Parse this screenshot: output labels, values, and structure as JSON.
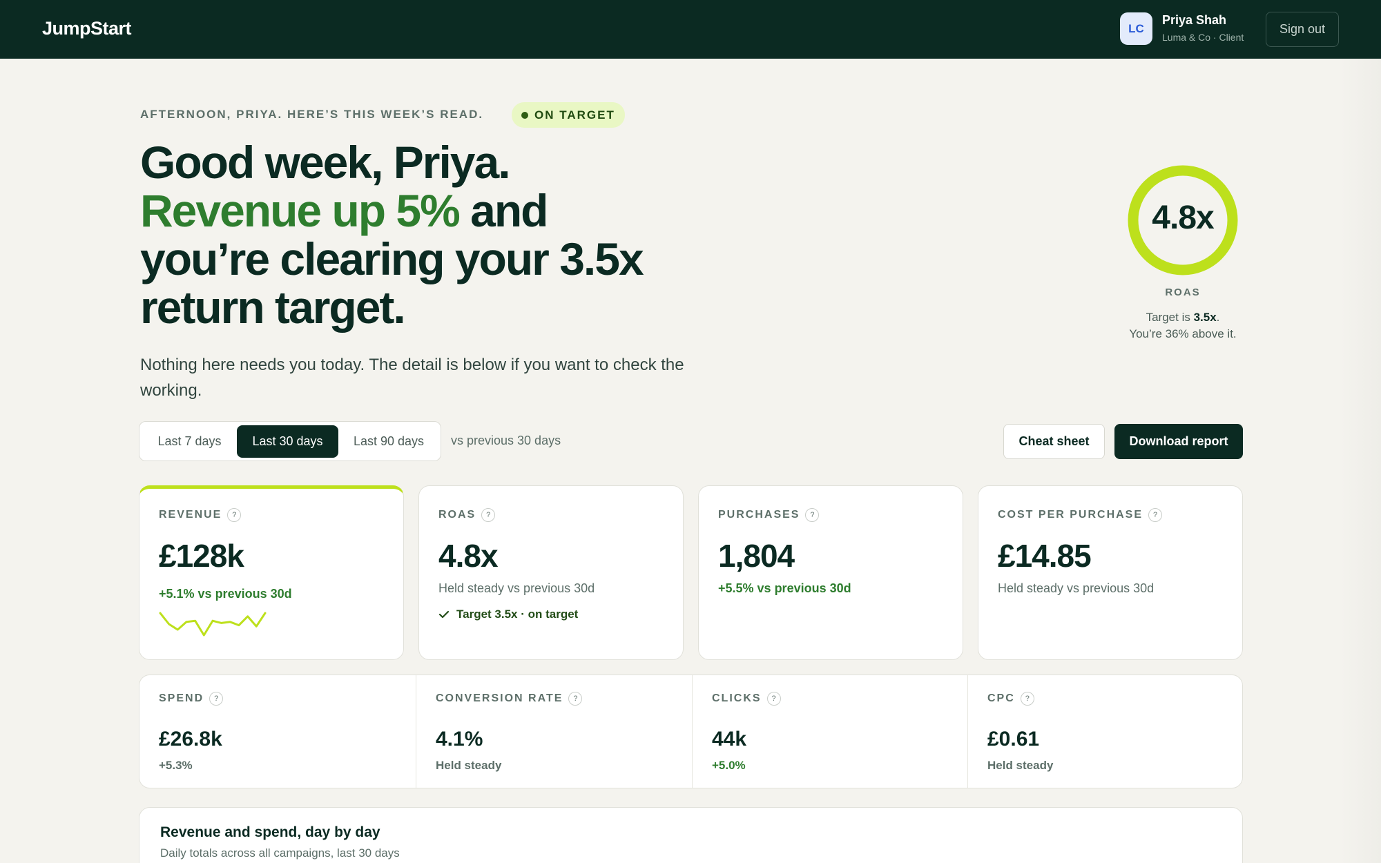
{
  "header": {
    "brand": "JumpStart",
    "avatar_initials": "LC",
    "user_name": "Priya Shah",
    "user_sub": "Luma & Co · Client",
    "signout_label": "Sign out"
  },
  "hero": {
    "kicker": "Afternoon, Priya. Here’s this week’s read.",
    "badge": "ON TARGET",
    "headline_line1": "Good week, Priya.",
    "headline_green": "Revenue up 5%",
    "headline_and": " and",
    "headline_line3": "you’re clearing your 3.5x",
    "headline_line4": "return target.",
    "lede": "Nothing here needs you today. The detail is below if you want to check the working."
  },
  "roas_ring": {
    "value": "4.8x",
    "label": "ROAS",
    "note_prefix": "Target is ",
    "note_target": "3.5x",
    "note_suffix": ".",
    "note_line2": "You’re 36% above it.",
    "fill_fraction": 1.0,
    "color": "#bde01c"
  },
  "range": {
    "options": [
      "Last 7 days",
      "Last 30 days",
      "Last 90 days"
    ],
    "selected": "Last 30 days",
    "compare_text": "vs previous 30 days"
  },
  "actions": {
    "cheat_sheet": "Cheat sheet",
    "download": "Download report"
  },
  "kpis": [
    {
      "label": "REVENUE",
      "help": "?",
      "value": "£128k",
      "delta": "+5.1% vs previous 30d"
    },
    {
      "label": "ROAS",
      "help": "?",
      "value": "4.8x",
      "delta": "Held steady vs previous 30d",
      "note": "Target 3.5x · on target"
    },
    {
      "label": "PURCHASES",
      "help": "?",
      "value": "1,804",
      "delta": "+5.5% vs previous 30d"
    },
    {
      "label": "COST PER PURCHASE",
      "help": "?",
      "value": "£14.85",
      "delta": "Held steady vs previous 30d"
    }
  ],
  "revenue_sparkline": [
    5,
    3,
    2,
    3.4,
    3.6,
    1,
    3.6,
    3.2,
    3.4,
    2.8,
    4.4,
    2.6,
    5
  ],
  "secondary": [
    {
      "label": "SPEND",
      "help": "?",
      "value": "£26.8k",
      "delta": "+5.3%"
    },
    {
      "label": "CONVERSION RATE",
      "help": "?",
      "value": "4.1%",
      "delta": "Held steady"
    },
    {
      "label": "CLICKS",
      "help": "?",
      "value": "44k",
      "delta": "+5.0%"
    },
    {
      "label": "CPC",
      "help": "?",
      "value": "£0.61",
      "delta": "Held steady"
    }
  ],
  "panel": {
    "title": "Revenue and spend, day by day",
    "subtitle": "Daily totals across all campaigns, last 30 days"
  },
  "colors": {
    "navy": "#0b2a22",
    "accent_lime": "#bde01c",
    "positive_green": "#2e7d2e"
  }
}
